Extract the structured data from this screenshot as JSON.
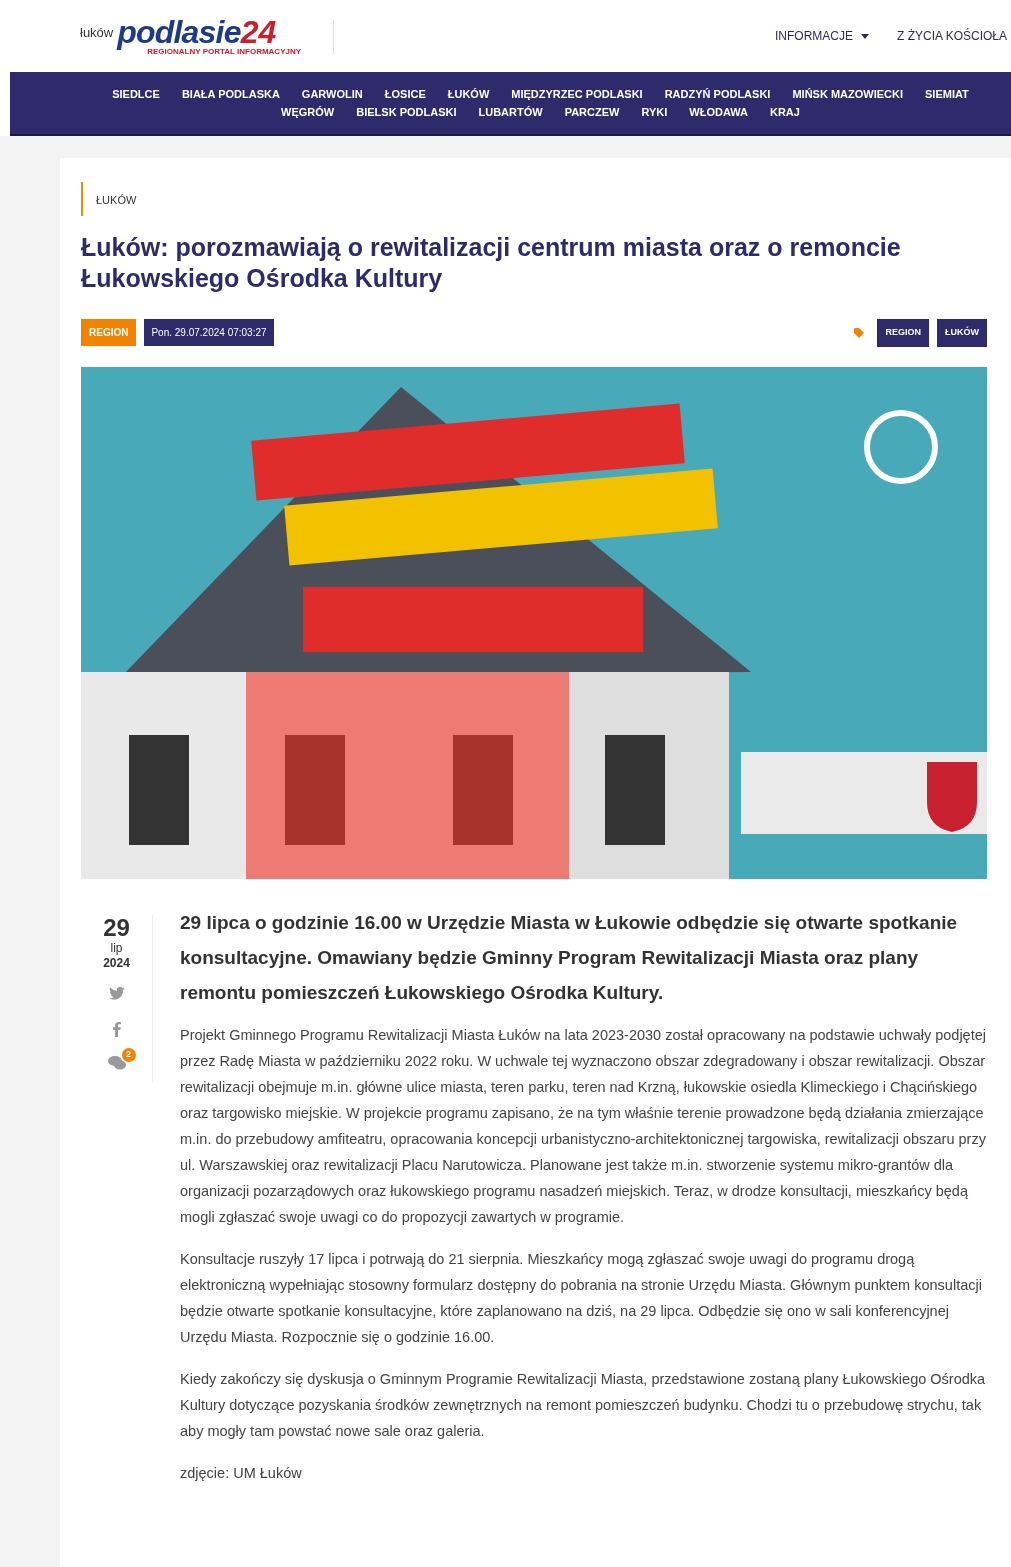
{
  "header": {
    "logo": {
      "prefix": "łuków",
      "name": "podlasie",
      "number": "24",
      "tagline": "REGIONALNY PORTAL INFORMACYJNY"
    },
    "menu": [
      {
        "label": "INFORMACJE",
        "dropdown": true
      },
      {
        "label": "Z ŻYCIA KOŚCIOŁA",
        "dropdown": false
      }
    ]
  },
  "nav": {
    "links": [
      "SIEDLCE",
      "BIAŁA PODLASKA",
      "GARWOLIN",
      "ŁOSICE",
      "ŁUKÓW",
      "MIĘDZYRZEC PODLASKI",
      "RADZYŃ PODLASKI",
      "MIŃSK MAZOWIECKI",
      "SIEMIAT",
      "WĘGRÓW",
      "BIELSK PODLASKI",
      "LUBARTÓW",
      "PARCZEW",
      "RYKI",
      "WŁODAWA",
      "KRAJ"
    ]
  },
  "article": {
    "breadcrumb": "ŁUKÓW",
    "title": "Łuków: porozmawiają o rewitalizacji centrum miasta oraz o remoncie Łukowskiego Ośrodka Kultury",
    "category": "REGION",
    "datetime": "Pon. 29.07.2024 07:03:27",
    "tags": [
      "REGION",
      "ŁUKÓW"
    ],
    "date": {
      "day": "29",
      "month": "lip",
      "year": "2024"
    },
    "comments": "2",
    "lead": "29 lipca o godzinie 16.00 w Urzędzie Miasta w Łukowie odbędzie się otwarte spotkanie konsultacyjne. Omawiany będzie Gminny Program Rewitalizacji Miasta oraz plany remontu pomieszczeń Łukowskiego Ośrodka Kultury.",
    "paragraphs": [
      "Projekt Gminnego Programu Rewitalizacji Miasta Łuków na lata 2023-2030 został opracowany na podstawie uchwały podjętej przez Radę Miasta w październiku 2022 roku. W uchwale tej wyznaczono obszar zdegradowany i obszar rewitalizacji. Obszar rewitalizacji obejmuje m.in. główne ulice miasta, teren parku, teren nad Krzną, łukowskie osiedla Klimeckiego i Chącińskiego oraz targowisko miejskie. W projekcie programu zapisano, że na tym właśnie terenie prowadzone będą działania zmierzające m.in. do przebudowy amfiteatru, opracowania koncepcji urbanistyczno-architektonicznej targowiska, rewitalizacji obszaru przy ul. Warszawskiej oraz rewitalizacji Placu Narutowicza. Planowane jest także m.in. stworzenie systemu mikro-grantów dla organizacji pozarządowych oraz łukowskiego programu nasadzeń miejskich. Teraz, w drodze konsultacji, mieszkańcy będą mogli zgłaszać swoje uwagi co do propozycji zawartych w programie.",
      "Konsultacje ruszyły 17 lipca i potrwają do 21 sierpnia. Mieszkańcy mogą zgłaszać swoje uwagi do programu drogą elektroniczną wypełniając stosowny formularz dostępny do pobrania na stronie Urzędu Miasta. Głównym punktem konsultacji będzie otwarte spotkanie konsultacyjne, które zaplanowano na dziś, na 29 lipca. Odbędzie się ono w sali konferencyjnej Urzędu Miasta. Rozpocznie się o godzinie 16.00.",
      "Kiedy zakończy się dyskusja o Gminnym Programie Rewitalizacji Miasta, przedstawione zostaną plany Łukowskiego Ośrodka Kultury dotyczące pozyskania środków zewnętrznych na remont pomieszczeń budynku. Chodzi tu o przebudowę strychu, tak aby mogły tam powstać nowe sale oraz galeria.",
      "zdjęcie: UM Łuków"
    ]
  }
}
